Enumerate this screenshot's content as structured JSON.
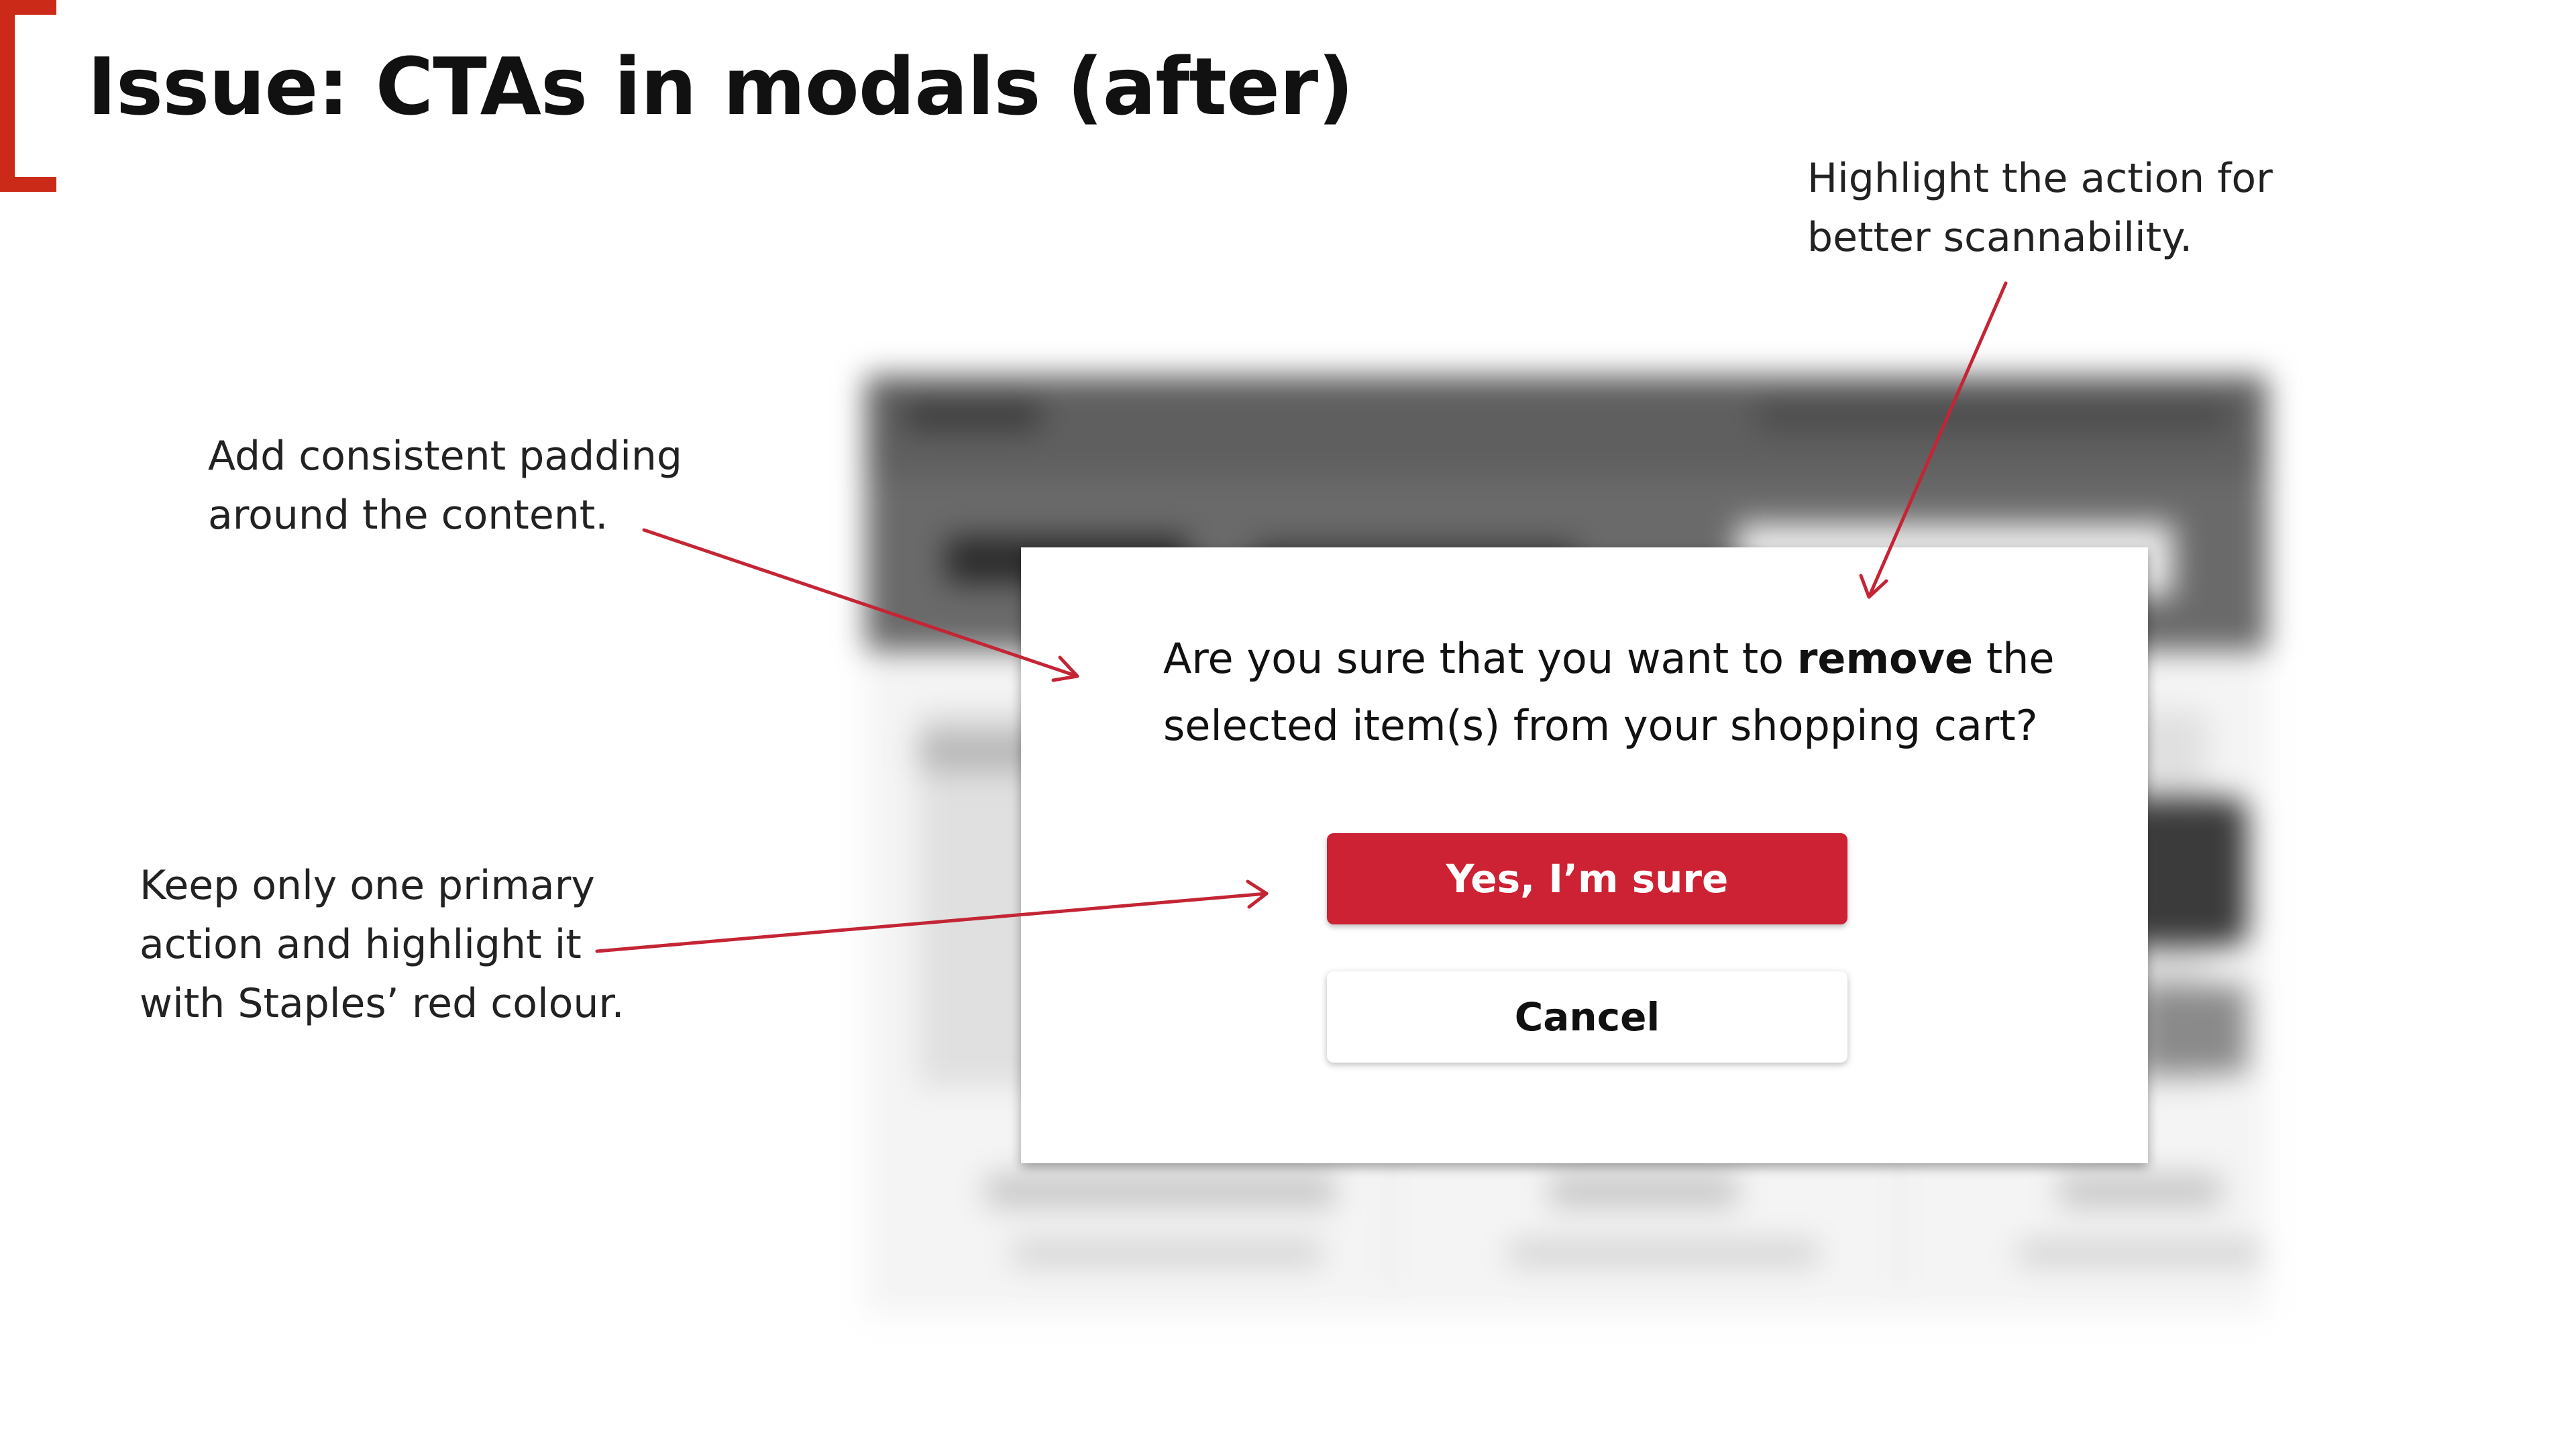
{
  "slide": {
    "title": "Issue: CTAs in modals (after)",
    "accent_color": "#cc2a18"
  },
  "annotations": {
    "highlight_action": [
      "Highlight the action for",
      "better scannability."
    ],
    "consistent_padding": [
      "Add consistent padding",
      "around the content."
    ],
    "primary_action": [
      "Keep only one primary",
      "action and highlight it",
      "with Staples’ red colour."
    ]
  },
  "modal": {
    "message_prefix": "Are you sure that you want to ",
    "message_emphasis": "remove",
    "message_suffix": " the",
    "message_line2": "selected item(s) from your shopping cart?",
    "primary_button": "Yes, I’m sure",
    "secondary_button": "Cancel",
    "primary_color": "#cc2233"
  },
  "icons": {
    "arrow": "arrow-icon"
  }
}
